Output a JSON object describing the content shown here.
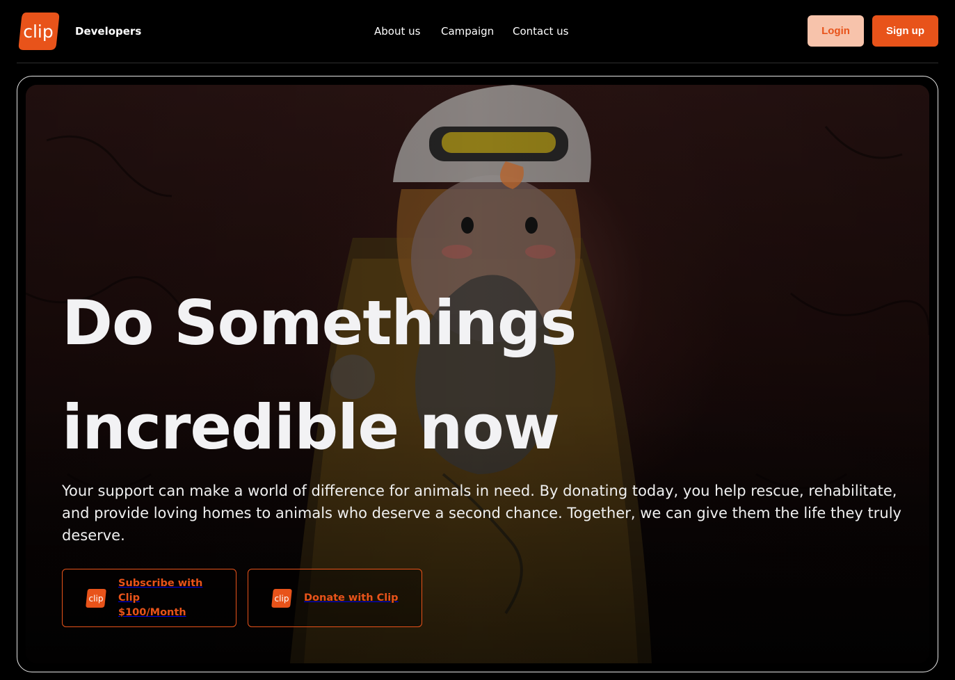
{
  "brand": {
    "logo_text": "clip",
    "subtitle": "Developers",
    "accent_color": "#e8531a"
  },
  "nav": {
    "items": [
      {
        "label": "About us"
      },
      {
        "label": "Campaign"
      },
      {
        "label": "Contact us"
      }
    ]
  },
  "auth": {
    "login_label": "Login",
    "signup_label": "Sign up"
  },
  "hero": {
    "headline_line1": "Do Somethings",
    "headline_line2": "incredible now",
    "lead": "Your support can make a world of difference for animals in need. By donating today, you help rescue, rehabilitate, and provide loving homes to animals who deserve a second chance. Together, we can give them the life they truly deserve.",
    "image_subject": "firefighter-holding-koala-illustration",
    "ctas": [
      {
        "label": "Subscribe with Clip $100/Month",
        "icon": "clip-logo-icon"
      },
      {
        "label": "Donate with Clip",
        "icon": "clip-logo-icon"
      }
    ]
  }
}
